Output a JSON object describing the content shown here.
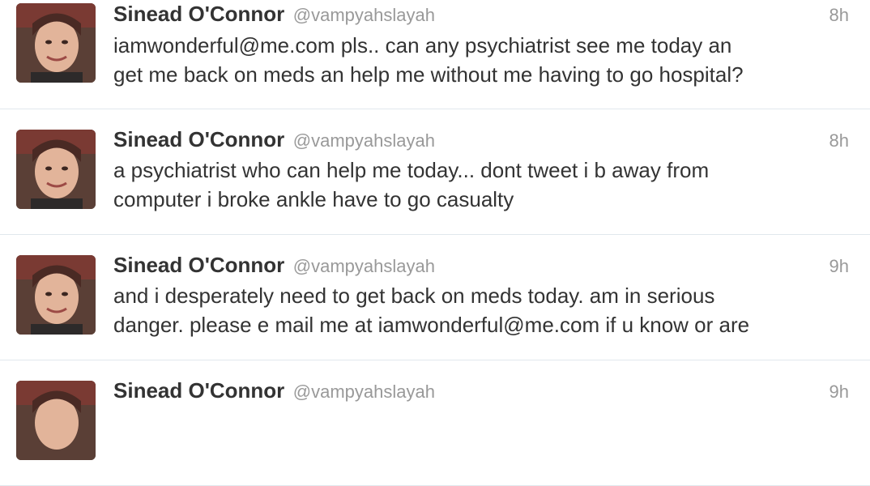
{
  "tweets": [
    {
      "fullname": "Sinead O'Connor",
      "username": "@vampyahslayah",
      "time": "8h",
      "line1": "iamwonderful@me.com pls.. can any psychiatrist see me today an",
      "line2": "get me back on meds an help me without me having to go hospital?"
    },
    {
      "fullname": "Sinead O'Connor",
      "username": "@vampyahslayah",
      "time": "8h",
      "line1": "a psychiatrist who can help me today... dont tweet i b away from",
      "line2": "computer i broke ankle have to go casualty"
    },
    {
      "fullname": "Sinead O'Connor",
      "username": "@vampyahslayah",
      "time": "9h",
      "line1": "and i desperately need to get back on meds today. am in serious",
      "line2": "danger. please e mail me at iamwonderful@me.com if u know or are"
    },
    {
      "fullname": "Sinead O'Connor",
      "username": "@vampyahslayah",
      "time": "9h",
      "line1": "",
      "line2": ""
    }
  ]
}
